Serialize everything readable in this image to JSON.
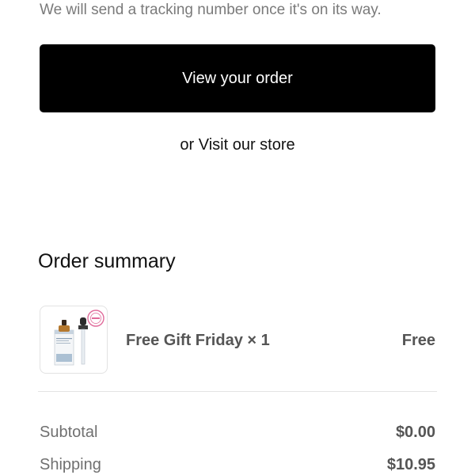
{
  "header": {
    "tracking_note": "We will send a tracking number once it's on its way."
  },
  "actions": {
    "view_order_label": "View your order",
    "store_prefix": "or",
    "store_link_label": "Visit our store"
  },
  "summary": {
    "title": "Order summary",
    "items": [
      {
        "name": "Free Gift Friday × 1",
        "price": "Free",
        "thumbnail_icon": "serum-bottle-icon"
      }
    ],
    "subtotal_label": "Subtotal",
    "subtotal_value": "$0.00",
    "shipping_label": "Shipping",
    "shipping_value": "$10.95"
  },
  "colors": {
    "button_bg": "#000000",
    "button_text": "#ffffff",
    "muted_text": "#7a7a7a",
    "value_text": "#555555",
    "badge_pink": "#e06a9a"
  }
}
